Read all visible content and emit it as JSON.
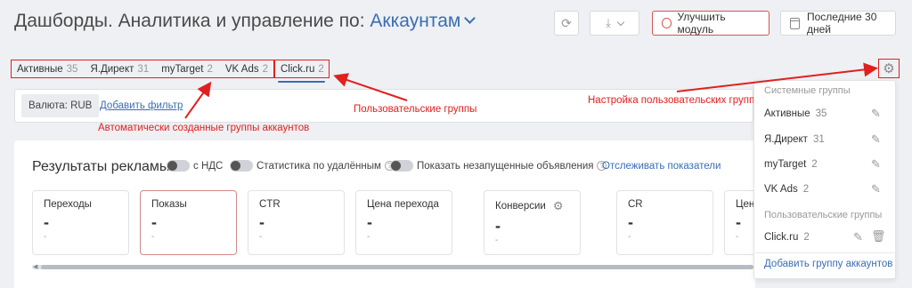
{
  "header": {
    "title": "Дашборды. Аналитика и управление по:",
    "scope_link": "Аккаунтам",
    "upgrade_label": "Улучшить модуль",
    "period_label": "Последние 30 дней"
  },
  "tabs": {
    "auto": [
      {
        "label": "Активные",
        "count": "35"
      },
      {
        "label": "Я.Директ",
        "count": "31"
      },
      {
        "label": "myTarget",
        "count": "2"
      },
      {
        "label": "VK Ads",
        "count": "2"
      }
    ],
    "custom": [
      {
        "label": "Click.ru",
        "count": "2"
      }
    ]
  },
  "filters": {
    "currency": "Валюта: RUB",
    "add_filter": "Добавить фильтр"
  },
  "annotations": {
    "auto_groups": "Автоматически созданные группы аккаунтов",
    "custom_groups": "Пользовательские группы",
    "settings": "Настройка пользовательских групп",
    "color": "#e02020"
  },
  "results": {
    "title": "Результаты рекламы",
    "vat_label": "с НДС",
    "deleted_label": "Статистика по удалённым",
    "not_started_label": "Показать незапущенные объявления",
    "track_link": "Отслеживать показатели",
    "cards": [
      {
        "label": "Переходы",
        "value": "-",
        "sub": "-"
      },
      {
        "label": "Показы",
        "value": "-",
        "sub": "-"
      },
      {
        "label": "CTR",
        "value": "-",
        "sub": "-"
      },
      {
        "label": "Цена перехода",
        "value": "-",
        "sub": "-"
      },
      {
        "label": "Конверсии",
        "value": "-",
        "sub": "-"
      },
      {
        "label": "CR",
        "value": "-",
        "sub": "-"
      },
      {
        "label": "Цен",
        "value": "-",
        "sub": "-"
      }
    ]
  },
  "dropdown": {
    "system_header": "Системные группы",
    "system_items": [
      {
        "label": "Активные",
        "count": "35"
      },
      {
        "label": "Я.Директ",
        "count": "31"
      },
      {
        "label": "myTarget",
        "count": "2"
      },
      {
        "label": "VK Ads",
        "count": "2"
      }
    ],
    "custom_header": "Пользовательские группы",
    "custom_items": [
      {
        "label": "Click.ru",
        "count": "2"
      }
    ],
    "add_group": "Добавить группу аккаунтов"
  },
  "colors": {
    "accent": "#3a6db5",
    "annotation": "#e02020"
  }
}
